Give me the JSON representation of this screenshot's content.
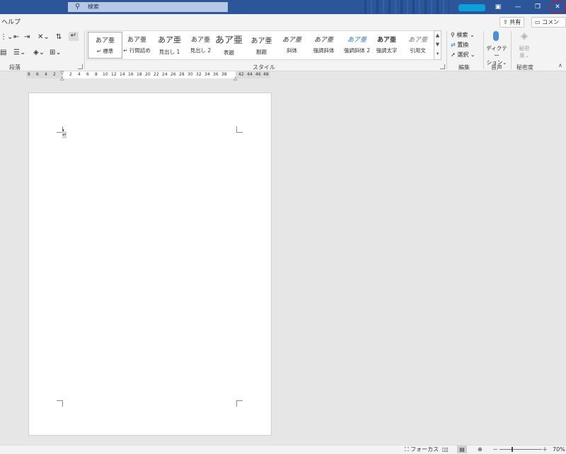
{
  "titlebar": {
    "search_placeholder": "検索",
    "colors": {
      "bar": "#2b579a",
      "close_mark": "#d0122c"
    }
  },
  "menu": {
    "help_tab": "ヘルプ",
    "share_label": "共有",
    "comment_label": "コメント"
  },
  "ribbon": {
    "paragraph_group_label": "段落",
    "styles_group_label": "スタイル",
    "edit_group_label": "編集",
    "voice_group_label": "音声",
    "sensitivity_group_label": "秘密度",
    "styles": [
      {
        "preview": "あア亜",
        "name": "↵ 標準"
      },
      {
        "preview": "あア亜",
        "name": "↵ 行間詰め"
      },
      {
        "preview": "あア亜",
        "name": "見出し 1"
      },
      {
        "preview": "あア亜",
        "name": "見出し 2"
      },
      {
        "preview": "あア亜",
        "name": "表題"
      },
      {
        "preview": "あア亜",
        "name": "副題"
      },
      {
        "preview": "あア亜",
        "name": "斜体"
      },
      {
        "preview": "あア亜",
        "name": "強調斜体"
      },
      {
        "preview": "あア亜",
        "name": "強調斜体 2"
      },
      {
        "preview": "あア亜",
        "name": "強調太字"
      },
      {
        "preview": "あア亜",
        "name": "引用文"
      }
    ],
    "edit": {
      "find_label": "検索",
      "replace_label": "置換",
      "select_label": "選択"
    },
    "dictate": {
      "line1": "ディクテー",
      "line2": "ション"
    },
    "sensitivity": {
      "line1": "秘密",
      "line2": "度"
    }
  },
  "ruler": {
    "left_ticks": [
      "8",
      "6",
      "4",
      "2"
    ],
    "right_ticks": [
      "2",
      "4",
      "6",
      "8",
      "10",
      "12",
      "14",
      "16",
      "18",
      "20",
      "22",
      "24",
      "26",
      "28",
      "30",
      "32",
      "34",
      "36",
      "38",
      "42",
      "44",
      "46",
      "48"
    ]
  },
  "document": {
    "paragraph_mark": "↵"
  },
  "statusbar": {
    "focus_label": "フォーカス",
    "zoom_level": "70%",
    "zoom_minus": "－",
    "zoom_plus": "＋"
  }
}
